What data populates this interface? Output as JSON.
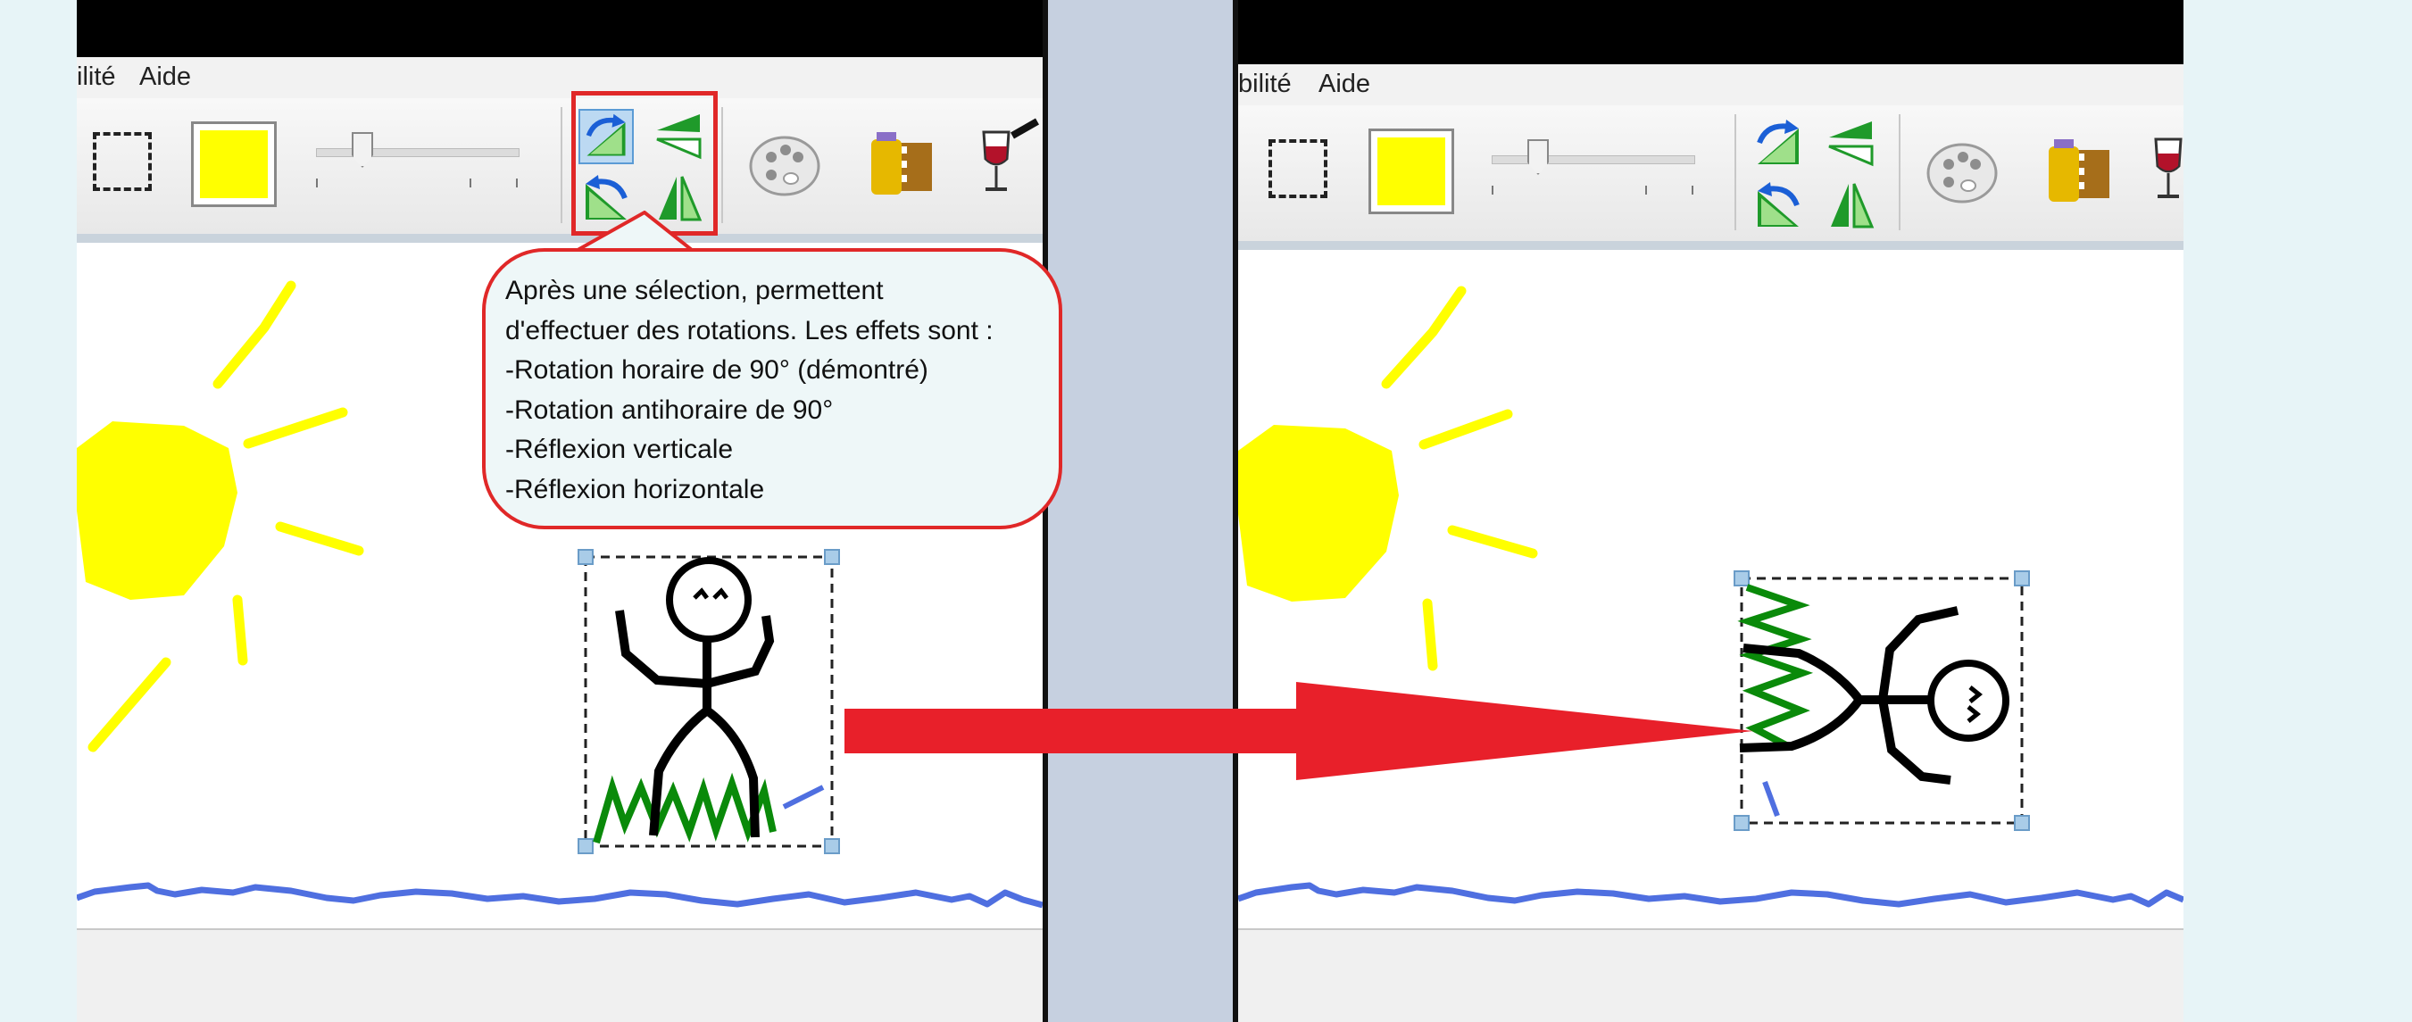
{
  "left_window": {
    "menu": {
      "item_1": "ilité",
      "item_2": "Aide"
    }
  },
  "right_window": {
    "menu": {
      "item_1": "bilité",
      "item_2": "Aide"
    }
  },
  "callout": {
    "lines": [
      "Après une sélection, permettent",
      "d'effectuer des rotations. Les effets sont :",
      "-Rotation horaire de 90° (démontré)",
      "-Rotation antihoraire de 90°",
      "-Réflexion verticale",
      "-Réflexion horizontale"
    ]
  },
  "colors": {
    "current_color": "#ffff00",
    "highlight": "#e02828",
    "sun": "#ffff00",
    "ground_line": "#4f6fe0",
    "grass": "#0a8a0a"
  },
  "icons": [
    "select-rectangle-icon",
    "rotate-clockwise-icon",
    "rotate-counterclockwise-icon",
    "flip-vertical-icon",
    "flip-horizontal-icon",
    "palette-icon",
    "film-roll-icon",
    "wine-glass-icon"
  ]
}
